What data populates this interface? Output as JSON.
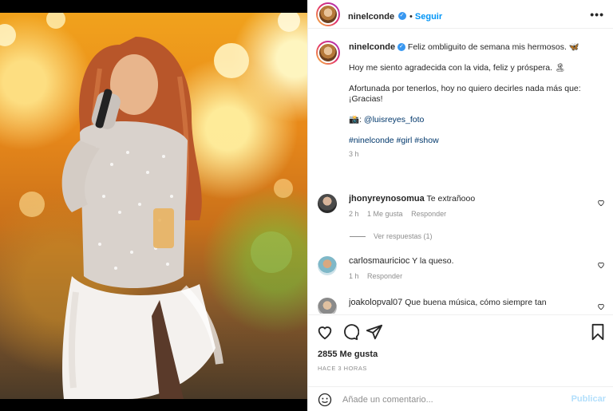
{
  "post": {
    "username": "ninelconde",
    "follow_label": "Seguir",
    "more_label": "•••",
    "caption": {
      "username": "ninelconde",
      "line1": "Feliz ombliguito de semana mis hermosos. 🦋",
      "line2": "Hoy me siento agradecida con la vida, feliz y próspera. 🏝",
      "line3a": "Afortunada por tenerlos, hoy no quiero decirles nada más que:",
      "line3b": "¡Gracias!",
      "photo_prefix": "📸:",
      "photo_credit": "@luisreyes_foto",
      "hashtags": "#ninelconde #girl #show",
      "time": "3 h"
    },
    "comments": [
      {
        "user": "jhonyreynosomua",
        "text": "Te extrañooo",
        "time": "2 h",
        "likes": "1 Me gusta",
        "reply": "Responder"
      },
      {
        "user": "carlosmauricioc",
        "text": "Y la queso.",
        "time": "1 h",
        "reply": "Responder"
      },
      {
        "user": "joakolopval07",
        "text": "Que buena música, cómo siempre tan"
      }
    ],
    "view_replies": "Ver respuestas (1)",
    "likes_count": "2855 Me gusta",
    "posted_ago": "HACE 3 HORAS",
    "comment_placeholder": "Añade un comentario...",
    "publish_label": "Publicar"
  },
  "icons": {
    "verified": "verified-badge-icon",
    "heart": "heart-icon",
    "comment": "comment-icon",
    "share": "share-icon",
    "bookmark": "bookmark-icon",
    "emoji": "emoji-icon"
  },
  "colors": {
    "link_blue": "#0095f6",
    "mention": "#00376b",
    "muted": "#8e8e8e",
    "verified": "#3897f0"
  }
}
